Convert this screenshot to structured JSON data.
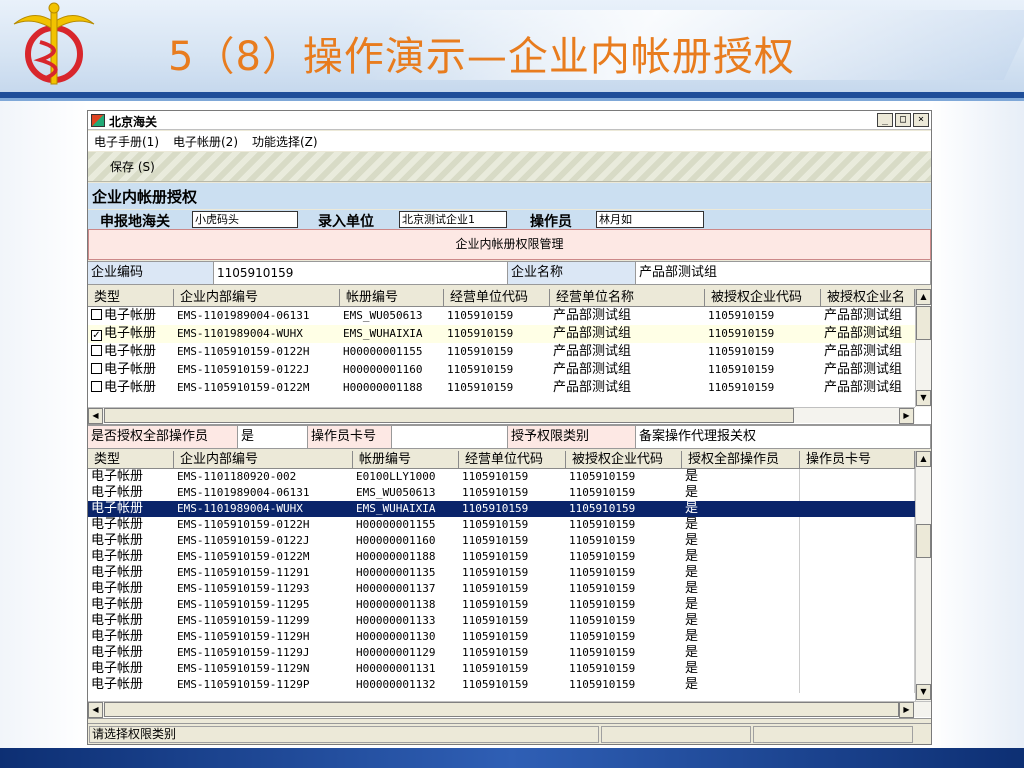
{
  "slide": {
    "title": "5（8）操作演示—企业内帐册授权",
    "colors": {
      "title": "#e87c1e",
      "header_bar": "#1f4e99",
      "footer": "#0d2f73"
    }
  },
  "window": {
    "title": "北京海关",
    "controls": [
      "_",
      "□",
      "×"
    ],
    "menu": [
      "电子手册(1)",
      "电子帐册(2)",
      "功能选择(Z)"
    ],
    "toolbar": {
      "save_label": "保存 (S)"
    },
    "section_title": "企业内帐册授权",
    "form": {
      "customs_label": "申报地海关",
      "customs_value": "小虎码头",
      "entry_unit_label": "录入单位",
      "entry_unit_value": "北京测试企业1",
      "operator_label": "操作员",
      "operator_value": "林月如"
    },
    "perm_header": "企业内帐册权限管理",
    "company": {
      "code_label": "企业编码",
      "code_value": "1105910159",
      "name_label": "企业名称",
      "name_value": "产品部测试组"
    },
    "grid1": {
      "columns": [
        "类型",
        "企业内部编号",
        "帐册编号",
        "经营单位代码",
        "经营单位名称",
        "被授权企业代码",
        "被授权企业名"
      ],
      "rows": [
        {
          "checked": false,
          "type": "电子帐册",
          "internal_no": "EMS-1101989004-06131",
          "book_no": "EMS_WU050613",
          "op_code": "1105910159",
          "op_name": "产品部测试组",
          "auth_code": "1105910159",
          "auth_name": "产品部测试组"
        },
        {
          "checked": true,
          "type": "电子帐册",
          "internal_no": "EMS-1101989004-WUHX",
          "book_no": "EMS_WUHAIXIA",
          "op_code": "1105910159",
          "op_name": "产品部测试组",
          "auth_code": "1105910159",
          "auth_name": "产品部测试组"
        },
        {
          "checked": false,
          "type": "电子帐册",
          "internal_no": "EMS-1105910159-0122H",
          "book_no": "H00000001155",
          "op_code": "1105910159",
          "op_name": "产品部测试组",
          "auth_code": "1105910159",
          "auth_name": "产品部测试组"
        },
        {
          "checked": false,
          "type": "电子帐册",
          "internal_no": "EMS-1105910159-0122J",
          "book_no": "H00000001160",
          "op_code": "1105910159",
          "op_name": "产品部测试组",
          "auth_code": "1105910159",
          "auth_name": "产品部测试组"
        },
        {
          "checked": false,
          "type": "电子帐册",
          "internal_no": "EMS-1105910159-0122M",
          "book_no": "H00000001188",
          "op_code": "1105910159",
          "op_name": "产品部测试组",
          "auth_code": "1105910159",
          "auth_name": "产品部测试组"
        }
      ]
    },
    "auth_row": {
      "all_label": "是否授权全部操作员",
      "all_value": "是",
      "card_label": "操作员卡号",
      "card_value": "",
      "type_label": "授予权限类别",
      "type_value": "备案操作代理报关权"
    },
    "grid2": {
      "columns": [
        "类型",
        "企业内部编号",
        "帐册编号",
        "经营单位代码",
        "被授权企业代码",
        "授权全部操作员",
        "操作员卡号"
      ],
      "rows": [
        {
          "type": "电子帐册",
          "internal_no": "EMS-1101180920-002",
          "book_no": "E0100LLY1000",
          "op_code": "1105910159",
          "auth_code": "1105910159",
          "all": "是",
          "card": ""
        },
        {
          "type": "电子帐册",
          "internal_no": "EMS-1101989004-06131",
          "book_no": "EMS_WU050613",
          "op_code": "1105910159",
          "auth_code": "1105910159",
          "all": "是",
          "card": ""
        },
        {
          "type": "电子帐册",
          "internal_no": "EMS-1101989004-WUHX",
          "book_no": "EMS_WUHAIXIA",
          "op_code": "1105910159",
          "auth_code": "1105910159",
          "all": "是",
          "card": ""
        },
        {
          "type": "电子帐册",
          "internal_no": "EMS-1105910159-0122H",
          "book_no": "H00000001155",
          "op_code": "1105910159",
          "auth_code": "1105910159",
          "all": "是",
          "card": ""
        },
        {
          "type": "电子帐册",
          "internal_no": "EMS-1105910159-0122J",
          "book_no": "H00000001160",
          "op_code": "1105910159",
          "auth_code": "1105910159",
          "all": "是",
          "card": ""
        },
        {
          "type": "电子帐册",
          "internal_no": "EMS-1105910159-0122M",
          "book_no": "H00000001188",
          "op_code": "1105910159",
          "auth_code": "1105910159",
          "all": "是",
          "card": ""
        },
        {
          "type": "电子帐册",
          "internal_no": "EMS-1105910159-11291",
          "book_no": "H00000001135",
          "op_code": "1105910159",
          "auth_code": "1105910159",
          "all": "是",
          "card": ""
        },
        {
          "type": "电子帐册",
          "internal_no": "EMS-1105910159-11293",
          "book_no": "H00000001137",
          "op_code": "1105910159",
          "auth_code": "1105910159",
          "all": "是",
          "card": ""
        },
        {
          "type": "电子帐册",
          "internal_no": "EMS-1105910159-11295",
          "book_no": "H00000001138",
          "op_code": "1105910159",
          "auth_code": "1105910159",
          "all": "是",
          "card": ""
        },
        {
          "type": "电子帐册",
          "internal_no": "EMS-1105910159-11299",
          "book_no": "H00000001133",
          "op_code": "1105910159",
          "auth_code": "1105910159",
          "all": "是",
          "card": ""
        },
        {
          "type": "电子帐册",
          "internal_no": "EMS-1105910159-1129H",
          "book_no": "H00000001130",
          "op_code": "1105910159",
          "auth_code": "1105910159",
          "all": "是",
          "card": ""
        },
        {
          "type": "电子帐册",
          "internal_no": "EMS-1105910159-1129J",
          "book_no": "H00000001129",
          "op_code": "1105910159",
          "auth_code": "1105910159",
          "all": "是",
          "card": ""
        },
        {
          "type": "电子帐册",
          "internal_no": "EMS-1105910159-1129N",
          "book_no": "H00000001131",
          "op_code": "1105910159",
          "auth_code": "1105910159",
          "all": "是",
          "card": ""
        },
        {
          "type": "电子帐册",
          "internal_no": "EMS-1105910159-1129P",
          "book_no": "H00000001132",
          "op_code": "1105910159",
          "auth_code": "1105910159",
          "all": "是",
          "card": ""
        }
      ]
    },
    "status": "请选择权限类别"
  }
}
